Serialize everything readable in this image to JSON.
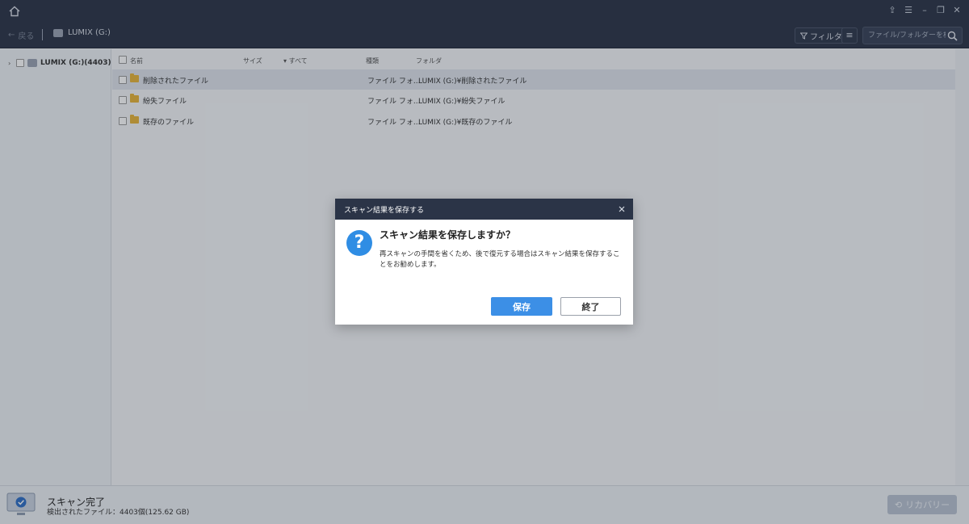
{
  "toolbar": {
    "back_label": "戻る",
    "drive_label": "LUMIX (G:)",
    "filter_label": "フィルター",
    "search_placeholder": "ファイル/フォルダーを検索"
  },
  "sidebar": {
    "items": [
      {
        "label": "LUMIX (G:)(4403)"
      }
    ]
  },
  "list": {
    "headers": {
      "name": "名前",
      "size": "サイズ",
      "filter_all": "すべて",
      "type": "種類",
      "folder": "フォルダ"
    },
    "rows": [
      {
        "name": "削除されたファイル",
        "type": "ファイル フォ...",
        "folder": "LUMIX (G:)¥削除されたファイル"
      },
      {
        "name": "紛失ファイル",
        "type": "ファイル フォ...",
        "folder": "LUMIX (G:)¥紛失ファイル"
      },
      {
        "name": "既存のファイル",
        "type": "ファイル フォ...",
        "folder": "LUMIX (G:)¥既存のファイル"
      }
    ]
  },
  "status": {
    "title": "スキャン完了",
    "subtitle": "検出されたファイル：4403個(125.62 GB)",
    "recover_label": "リカバリー"
  },
  "dialog": {
    "header": "スキャン結果を保存する",
    "title": "スキャン結果を保存しますか？",
    "message": "再スキャンの手間を省くため、後で復元する場合はスキャン結果を保存することをお勧めします。",
    "save_label": "保存",
    "exit_label": "終了"
  },
  "colors": {
    "titlebar": "#2b3447",
    "accent": "#3c8fe6",
    "folder": "#e8b43a"
  }
}
